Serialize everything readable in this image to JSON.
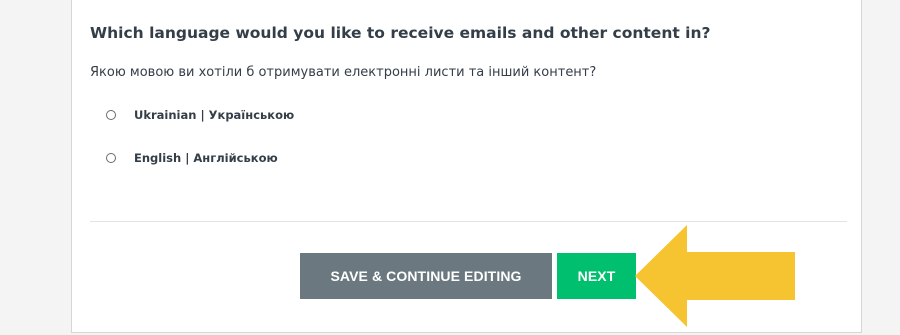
{
  "question": {
    "title": "Which language would you like to receive emails and other content in?",
    "subtitle": "Якою мовою ви хотіли б отримувати електронні листи та інший контент?"
  },
  "options": [
    {
      "label": "Ukrainian | Українською",
      "selected": false
    },
    {
      "label": "English | Англійською",
      "selected": false
    }
  ],
  "buttons": {
    "save_label": "SAVE & CONTINUE EDITING",
    "next_label": "NEXT"
  },
  "colors": {
    "save_button": "#6b787f",
    "next_button": "#00bf6f",
    "arrow": "#f6c331"
  },
  "annotation": {
    "icon": "arrow-left-icon"
  }
}
